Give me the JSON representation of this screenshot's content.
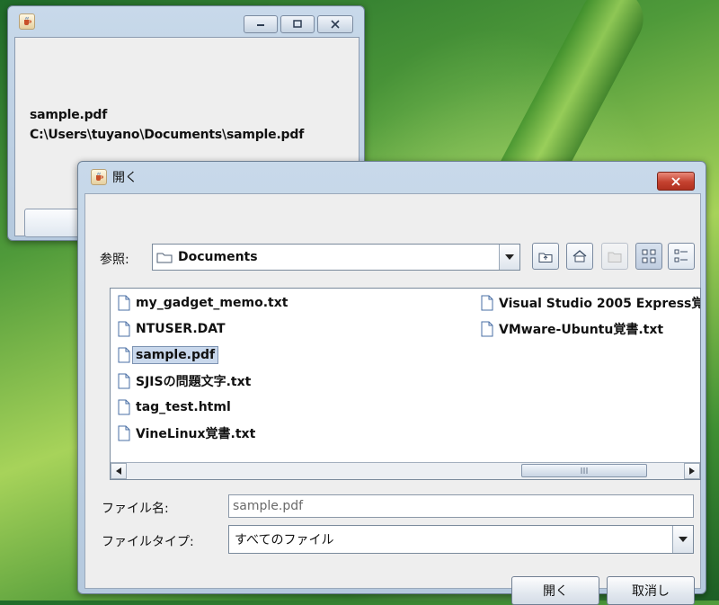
{
  "main_window": {
    "filename": "sample.pdf",
    "filepath": "C:\\Users\\tuyano\\Documents\\sample.pdf"
  },
  "dialog": {
    "title": "開く",
    "look_in_label": "参照:",
    "look_in_value": "Documents",
    "files": [
      {
        "name": "my_gadget_memo.txt",
        "selected": false
      },
      {
        "name": "NTUSER.DAT",
        "selected": false
      },
      {
        "name": "sample.pdf",
        "selected": true
      },
      {
        "name": "SJISの問題文字.txt",
        "selected": false
      },
      {
        "name": "tag_test.html",
        "selected": false
      },
      {
        "name": "VineLinux覚書.txt",
        "selected": false
      },
      {
        "name": "Visual Studio 2005 Express覚",
        "selected": false
      },
      {
        "name": "VMware-Ubuntu覚書.txt",
        "selected": false
      }
    ],
    "filename_label": "ファイル名:",
    "filename_value": "sample.pdf",
    "filetype_label": "ファイルタイプ:",
    "filetype_value": "すべてのファイル",
    "open_button": "開く",
    "cancel_button": "取消し"
  },
  "icons": {
    "window_icon": "java-cup-icon",
    "file_icon": "document-icon",
    "toolbar": [
      "up-folder-icon",
      "home-icon",
      "new-folder-icon",
      "list-view-icon",
      "details-view-icon"
    ]
  },
  "colors": {
    "selection": "#c9d8ec",
    "close_button": "#c4412f",
    "window_frame": "#c8d9ea"
  }
}
